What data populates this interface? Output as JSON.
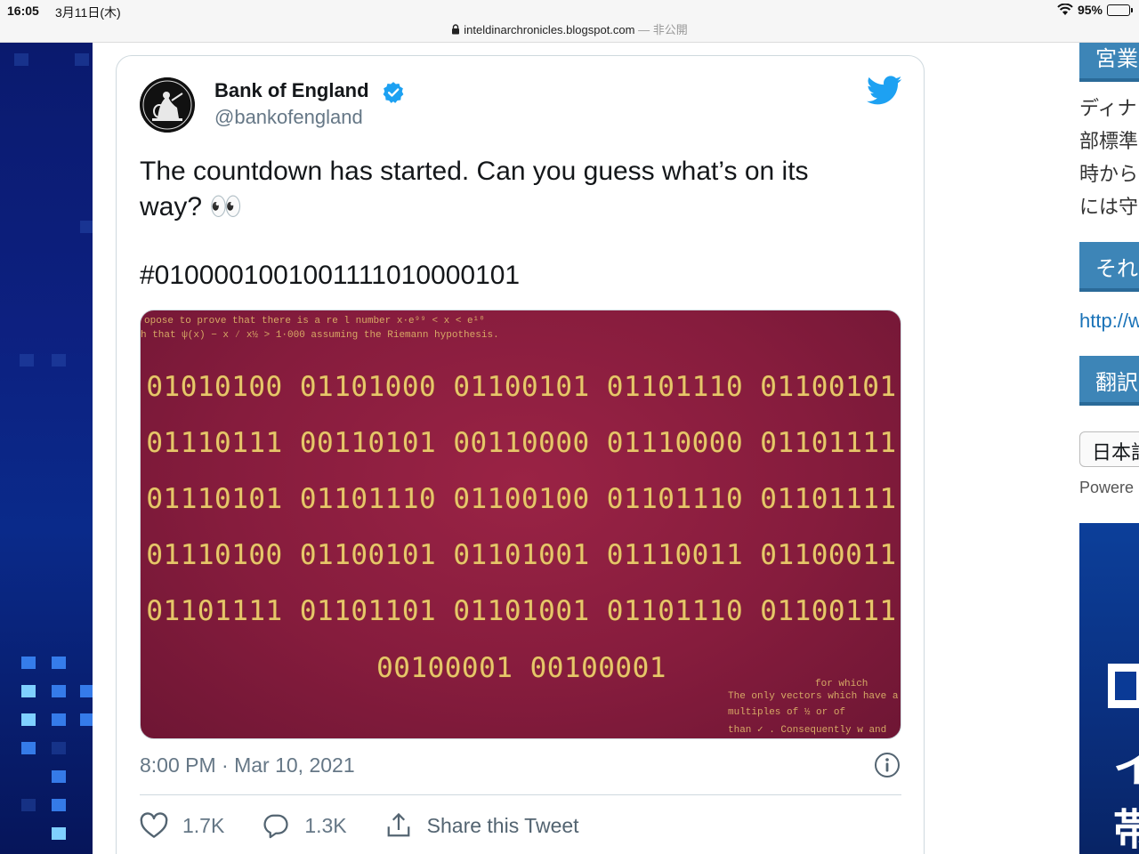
{
  "status_bar": {
    "time": "16:05",
    "date": "3月11日(木)",
    "battery": "95%"
  },
  "browser": {
    "domain": "inteldinarchronicles.blogspot.com",
    "suffix": " — 非公開"
  },
  "tweet": {
    "author_name": "Bank of England",
    "handle": "@bankofengland",
    "text": "The countdown has started. Can you guess what’s on its way? 👀",
    "hashtag": "#0100001001001111010000101",
    "media": {
      "binary_rows": [
        "01010100 01101000 01100101 01101110 01100101",
        "01110111 00110101 00110000 01110000 01101111",
        "01110101 01101110 01100100 01101110 01101111",
        "01110100 01100101 01101001 01110011 01100011",
        "01101111 01101101 01101001 01101110 01100111",
        "00100001 00100001"
      ],
      "scribbles": [
        "opose to prove that there is a re l number x·e⁹⁹ < x < e¹⁰",
        "h that ψ(x) − x ⁄ x½ > 1·000 assuming the Riemann hypothesis.",
        "for which",
        "The only vectors which have a",
        "multiples of ½ or of",
        "than ✓ . Consequently w and"
      ]
    },
    "timestamp": "8:00 PM · Mar 10, 2021",
    "likes": "1.7K",
    "replies": "1.3K",
    "share_label": "Share this Tweet"
  },
  "sidebar": {
    "heading_1": "宮業",
    "text_lines": [
      "ディナ",
      "部標準",
      "時から",
      "には守"
    ],
    "heading_2": "それ",
    "link": "http://w",
    "heading_3": "翻訳",
    "select_value": "日本語",
    "powered": "Powere",
    "banner_glyphs": [
      "イ",
      "帯"
    ]
  },
  "colors": {
    "twitter_blue": "#1da1f2",
    "passport_red": "#861c3d",
    "gold": "#e7c66a",
    "sidebar_blue": "#3d85b7"
  },
  "icons": [
    "lock-icon",
    "wifi-icon",
    "battery-icon",
    "verified-badge-icon",
    "twitter-bird-icon",
    "info-icon",
    "heart-icon",
    "reply-icon",
    "share-icon"
  ]
}
